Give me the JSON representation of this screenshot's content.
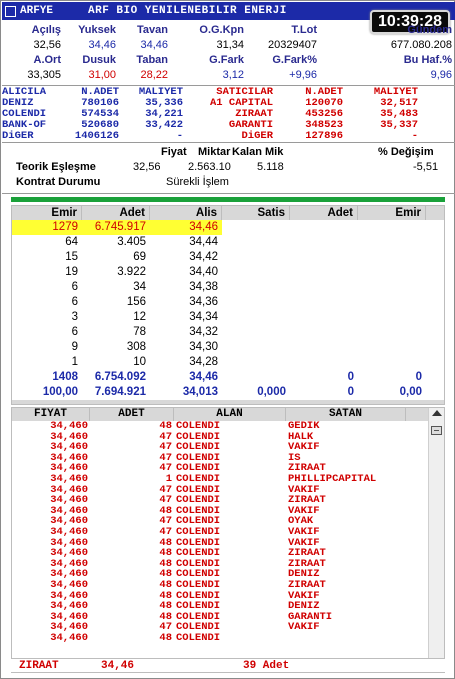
{
  "title": {
    "symbol": "ARFYE",
    "name": "ARF BIO YENILENEBILIR ENERJI",
    "clock": "10:39:28"
  },
  "row1_labels": [
    "Açılış",
    "Yuksek",
    "Tavan",
    "O.G.Kpn",
    "T.Lot",
    "Gündem"
  ],
  "row1_values": [
    "32,56",
    "34,46",
    "34,46",
    "31,34",
    "20329407",
    "677.080.208"
  ],
  "row2_labels": [
    "A.Ort",
    "Dusuk",
    "Taban",
    "G.Fark",
    "G.Fark%",
    "Bu Haf.%"
  ],
  "row2_values": [
    "33,305",
    "31,00",
    "28,22",
    "3,12",
    "+9,96",
    "9,96"
  ],
  "brokers": {
    "headers": [
      "ALICILA",
      "N.ADET",
      "MALIYET",
      "SATICILAR",
      "N.ADET",
      "MALIYET"
    ],
    "rows": [
      [
        "DENIZ",
        "780106",
        "35,336",
        "A1 CAPITAL",
        "120070",
        "32,517"
      ],
      [
        "COLENDI",
        "574534",
        "34,221",
        "ZIRAAT",
        "453256",
        "35,483"
      ],
      [
        "BANK-OF",
        "520680",
        "33,422",
        "GARANTI",
        "348523",
        "35,337"
      ],
      [
        "DiGER",
        "1406126",
        "-",
        "DiGER",
        "127896",
        "-"
      ]
    ]
  },
  "theo": {
    "fiyat_label": "Fiyat",
    "miktar_label": "Miktar",
    "kalan_label": "Kalan Mik",
    "degisim_label": "% Değişim",
    "row_label": "Teorik Eşleşme",
    "fiyat": "32,56",
    "miktar": "2.563.10",
    "kalan": "5.118",
    "degisim": "-5,51",
    "status_label": "Kontrat Durumu",
    "status": "Sürekli İşlem"
  },
  "depth": {
    "headers": [
      "Emir",
      "Adet",
      "Alis",
      "Satis",
      "Adet",
      "Emir"
    ],
    "rows": [
      [
        "1279",
        "6.745.917",
        "34,46",
        "",
        "",
        ""
      ],
      [
        "64",
        "3.405",
        "34,44",
        "",
        "",
        ""
      ],
      [
        "15",
        "69",
        "34,42",
        "",
        "",
        ""
      ],
      [
        "19",
        "3.922",
        "34,40",
        "",
        "",
        ""
      ],
      [
        "6",
        "34",
        "34,38",
        "",
        "",
        ""
      ],
      [
        "6",
        "156",
        "34,36",
        "",
        "",
        ""
      ],
      [
        "3",
        "12",
        "34,34",
        "",
        "",
        ""
      ],
      [
        "6",
        "78",
        "34,32",
        "",
        "",
        ""
      ],
      [
        "9",
        "308",
        "34,30",
        "",
        "",
        ""
      ],
      [
        "1",
        "10",
        "34,28",
        "",
        "",
        ""
      ]
    ],
    "total1": [
      "1408",
      "6.754.092",
      "34,46",
      "",
      "0",
      "0"
    ],
    "total2": [
      "100,00",
      "7.694.921",
      "34,013",
      "0,000",
      "0",
      "0,00"
    ]
  },
  "trades": {
    "headers": [
      "FIYAT",
      "ADET",
      "ALAN",
      "SATAN"
    ],
    "rows": [
      [
        "34,460",
        "48",
        "COLENDI",
        "GEDIK"
      ],
      [
        "34,460",
        "47",
        "COLENDI",
        "HALK"
      ],
      [
        "34,460",
        "47",
        "COLENDI",
        "VAKIF"
      ],
      [
        "34,460",
        "47",
        "COLENDI",
        "IS"
      ],
      [
        "34,460",
        "47",
        "COLENDI",
        "ZIRAAT"
      ],
      [
        "34,460",
        "1",
        "COLENDI",
        "PHILLIPCAPITAL"
      ],
      [
        "34,460",
        "47",
        "COLENDI",
        "VAKIF"
      ],
      [
        "34,460",
        "47",
        "COLENDI",
        "ZIRAAT"
      ],
      [
        "34,460",
        "48",
        "COLENDI",
        "VAKIF"
      ],
      [
        "34,460",
        "47",
        "COLENDI",
        "OYAK"
      ],
      [
        "34,460",
        "47",
        "COLENDI",
        "VAKIF"
      ],
      [
        "34,460",
        "48",
        "COLENDI",
        "VAKIF"
      ],
      [
        "34,460",
        "48",
        "COLENDI",
        "ZIRAAT"
      ],
      [
        "34,460",
        "48",
        "COLENDI",
        "ZIRAAT"
      ],
      [
        "34,460",
        "48",
        "COLENDI",
        "DENIZ"
      ],
      [
        "34,460",
        "48",
        "COLENDI",
        "ZIRAAT"
      ],
      [
        "34,460",
        "48",
        "COLENDI",
        "VAKIF"
      ],
      [
        "34,460",
        "48",
        "COLENDI",
        "DENIZ"
      ],
      [
        "34,460",
        "48",
        "COLENDI",
        "GARANTI"
      ],
      [
        "34,460",
        "47",
        "COLENDI",
        "VAKIF"
      ],
      [
        "34,460",
        "48",
        "COLENDI",
        ""
      ]
    ]
  },
  "footer": {
    "broker": "ZIRAAT",
    "price": "34,46",
    "qty": "39 Adet"
  }
}
